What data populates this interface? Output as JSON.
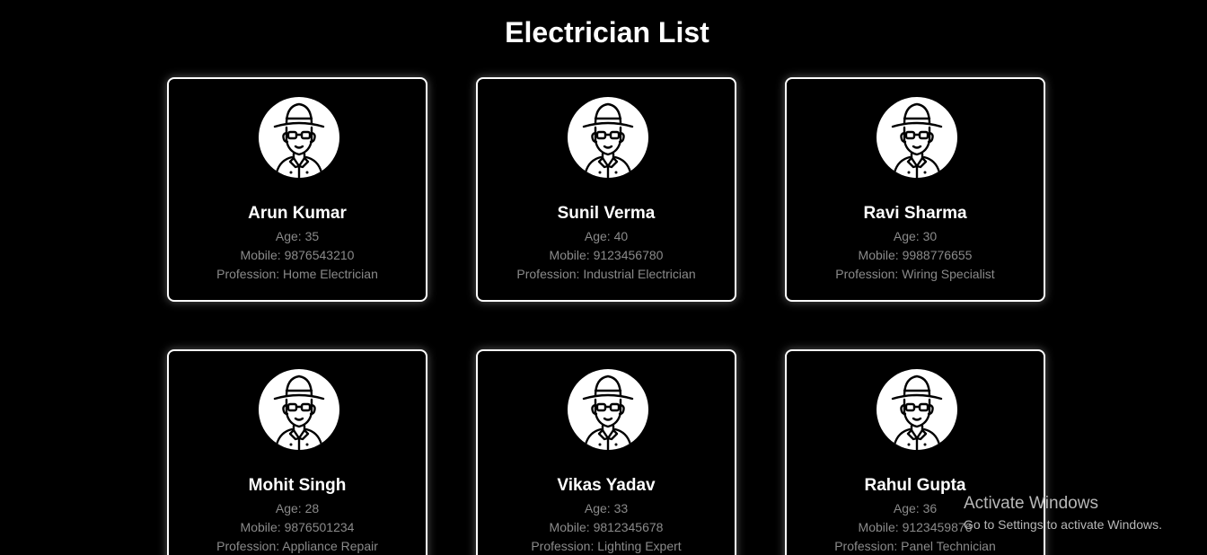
{
  "page": {
    "title": "Electrician List"
  },
  "labels": {
    "age_prefix": "Age: ",
    "mobile_prefix": "Mobile: ",
    "profession_prefix": "Profession: "
  },
  "avatar_icon": "electrician-avatar-icon",
  "electricians": [
    {
      "name": "Arun Kumar",
      "age": "35",
      "mobile": "9876543210",
      "profession": "Home Electrician"
    },
    {
      "name": "Sunil Verma",
      "age": "40",
      "mobile": "9123456780",
      "profession": "Industrial Electrician"
    },
    {
      "name": "Ravi Sharma",
      "age": "30",
      "mobile": "9988776655",
      "profession": "Wiring Specialist"
    },
    {
      "name": "Mohit Singh",
      "age": "28",
      "mobile": "9876501234",
      "profession": "Appliance Repair"
    },
    {
      "name": "Vikas Yadav",
      "age": "33",
      "mobile": "9812345678",
      "profession": "Lighting Expert"
    },
    {
      "name": "Rahul Gupta",
      "age": "36",
      "mobile": "9123459876",
      "profession": "Panel Technician"
    }
  ],
  "watermark": {
    "title": "Activate Windows",
    "subtitle": "Go to Settings to activate Windows."
  }
}
